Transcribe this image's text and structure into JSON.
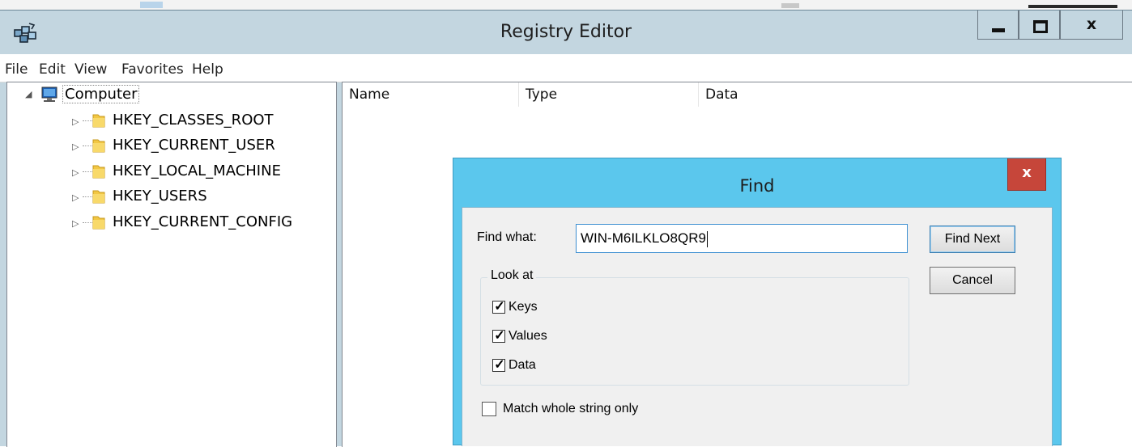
{
  "window": {
    "title": "Registry Editor",
    "icon": "registry-editor-icon",
    "controls": {
      "minimize_icon": "minimize-icon",
      "maximize_icon": "maximize-icon",
      "close_label": "x"
    }
  },
  "menu": {
    "items": [
      "File",
      "Edit",
      "View",
      "Favorites",
      "Help"
    ]
  },
  "tree": {
    "root": {
      "label": "Computer",
      "icon": "computer-icon",
      "expanded": true
    },
    "children": [
      {
        "label": "HKEY_CLASSES_ROOT",
        "icon": "folder-icon"
      },
      {
        "label": "HKEY_CURRENT_USER",
        "icon": "folder-icon"
      },
      {
        "label": "HKEY_LOCAL_MACHINE",
        "icon": "folder-icon"
      },
      {
        "label": "HKEY_USERS",
        "icon": "folder-icon"
      },
      {
        "label": "HKEY_CURRENT_CONFIG",
        "icon": "folder-icon"
      }
    ]
  },
  "list": {
    "columns": [
      "Name",
      "Type",
      "Data"
    ]
  },
  "find_dialog": {
    "title": "Find",
    "close_label": "x",
    "find_what_label": "Find what:",
    "find_what_value": "WIN-M6ILKLO8QR9",
    "find_next_label": "Find Next",
    "cancel_label": "Cancel",
    "look_at": {
      "legend": "Look at",
      "options": [
        {
          "label": "Keys",
          "checked": true
        },
        {
          "label": "Values",
          "checked": true
        },
        {
          "label": "Data",
          "checked": true
        }
      ]
    },
    "match_whole": {
      "label": "Match whole string only",
      "checked": false
    }
  },
  "colors": {
    "titlebar": "#c3d6e0",
    "dialog_frame": "#5bc7ed",
    "dialog_close": "#c6463a",
    "input_focus_border": "#3d8fd1"
  }
}
